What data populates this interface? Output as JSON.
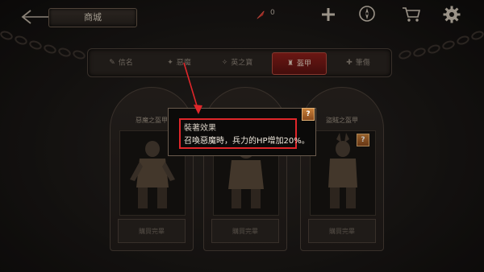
{
  "header": {
    "title": "商城",
    "currency_value": "0"
  },
  "icons": {
    "back": "back-arrow-icon",
    "currency": "red-quill-icon",
    "plus": "plus-icon",
    "compass": "compass-icon",
    "cart": "cart-icon",
    "settings": "gear-icon"
  },
  "tabs": [
    {
      "label": "信名",
      "active": false
    },
    {
      "label": "惡魔",
      "active": false
    },
    {
      "label": "英之寶",
      "active": false
    },
    {
      "label": "盔甲",
      "active": true
    },
    {
      "label": "筆傷",
      "active": false
    }
  ],
  "cards": [
    {
      "name": "惡魔之盔甲",
      "button": "購買完畢"
    },
    {
      "name": "",
      "button": "購買完畢"
    },
    {
      "name": "盜賊之盔甲",
      "button": "購買完畢"
    }
  ],
  "tooltip": {
    "title": "裝著效果",
    "body": "召喚惡魔時，兵力的HP增加20%。",
    "help": "?"
  },
  "colors": {
    "highlight": "#e0262a",
    "active_tab": "#8e1f1a",
    "help_icon": "#c9813a"
  }
}
